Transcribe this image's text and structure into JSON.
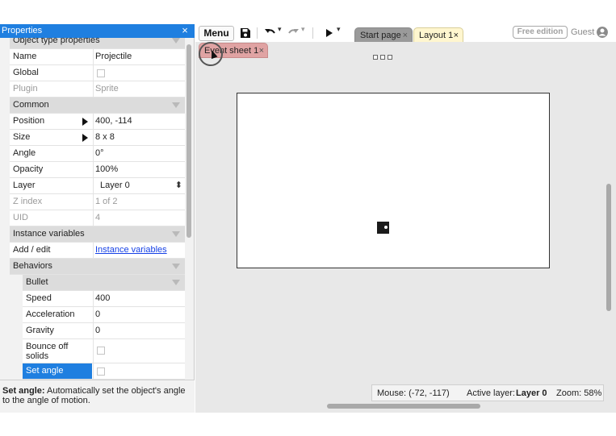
{
  "properties_panel": {
    "title": "Properties",
    "close_glyph": "×",
    "section_object_type": "Object type properties",
    "name": {
      "label": "Name",
      "value": "Projectile"
    },
    "global": {
      "label": "Global",
      "checked": false
    },
    "plugin": {
      "label": "Plugin",
      "value": "Sprite"
    },
    "section_common": "Common",
    "position": {
      "label": "Position",
      "value": "400, -114"
    },
    "size": {
      "label": "Size",
      "value": "8 x 8"
    },
    "angle": {
      "label": "Angle",
      "value": "0°"
    },
    "opacity": {
      "label": "Opacity",
      "value": "100%"
    },
    "layer": {
      "label": "Layer",
      "value": "Layer 0",
      "arrows": "⬍"
    },
    "zindex": {
      "label": "Z index",
      "value": "1 of 2"
    },
    "uid": {
      "label": "UID",
      "value": "4"
    },
    "section_instance_variables": "Instance variables",
    "add_edit": {
      "label": "Add / edit",
      "value": "Instance variables"
    },
    "section_behaviors": "Behaviors",
    "section_bullet": "Bullet",
    "speed": {
      "label": "Speed",
      "value": "400"
    },
    "acceleration": {
      "label": "Acceleration",
      "value": "0"
    },
    "gravity": {
      "label": "Gravity",
      "value": "0"
    },
    "bounce_off_solids": {
      "label": "Bounce off solids",
      "checked": false
    },
    "set_angle": {
      "label": "Set angle",
      "checked": false
    },
    "description": {
      "title": "Set angle:",
      "text": "Automatically set the object's angle to the angle of motion."
    }
  },
  "toolbar": {
    "menu_label": "Menu",
    "icons": [
      "save-icon",
      "undo-icon",
      "redo-icon",
      "play-icon"
    ],
    "dropdown_glyph": "▾",
    "tabs": [
      {
        "label": "Start page",
        "close": "×"
      },
      {
        "label": "Layout 1",
        "close": "×"
      }
    ],
    "edition_badge": "Free edition",
    "user_label": "Guest"
  },
  "editor": {
    "event_sheet_tab": {
      "label": "Event sheet 1",
      "close": "×"
    },
    "status": {
      "mouse": "Mouse: (-72, -117)",
      "active_layer_label": "Active layer:",
      "active_layer_value": "Layer 0",
      "zoom": "Zoom: 58%"
    }
  },
  "colors": {
    "panel_title_bg": "#1f7fe0",
    "selected_row_bg": "#1f7fe0",
    "link": "#1540e6",
    "event_tab_bg": "#e0a3a3",
    "layout_tab_bg": "#fff6cf",
    "start_tab_bg": "#9a9a9a"
  }
}
